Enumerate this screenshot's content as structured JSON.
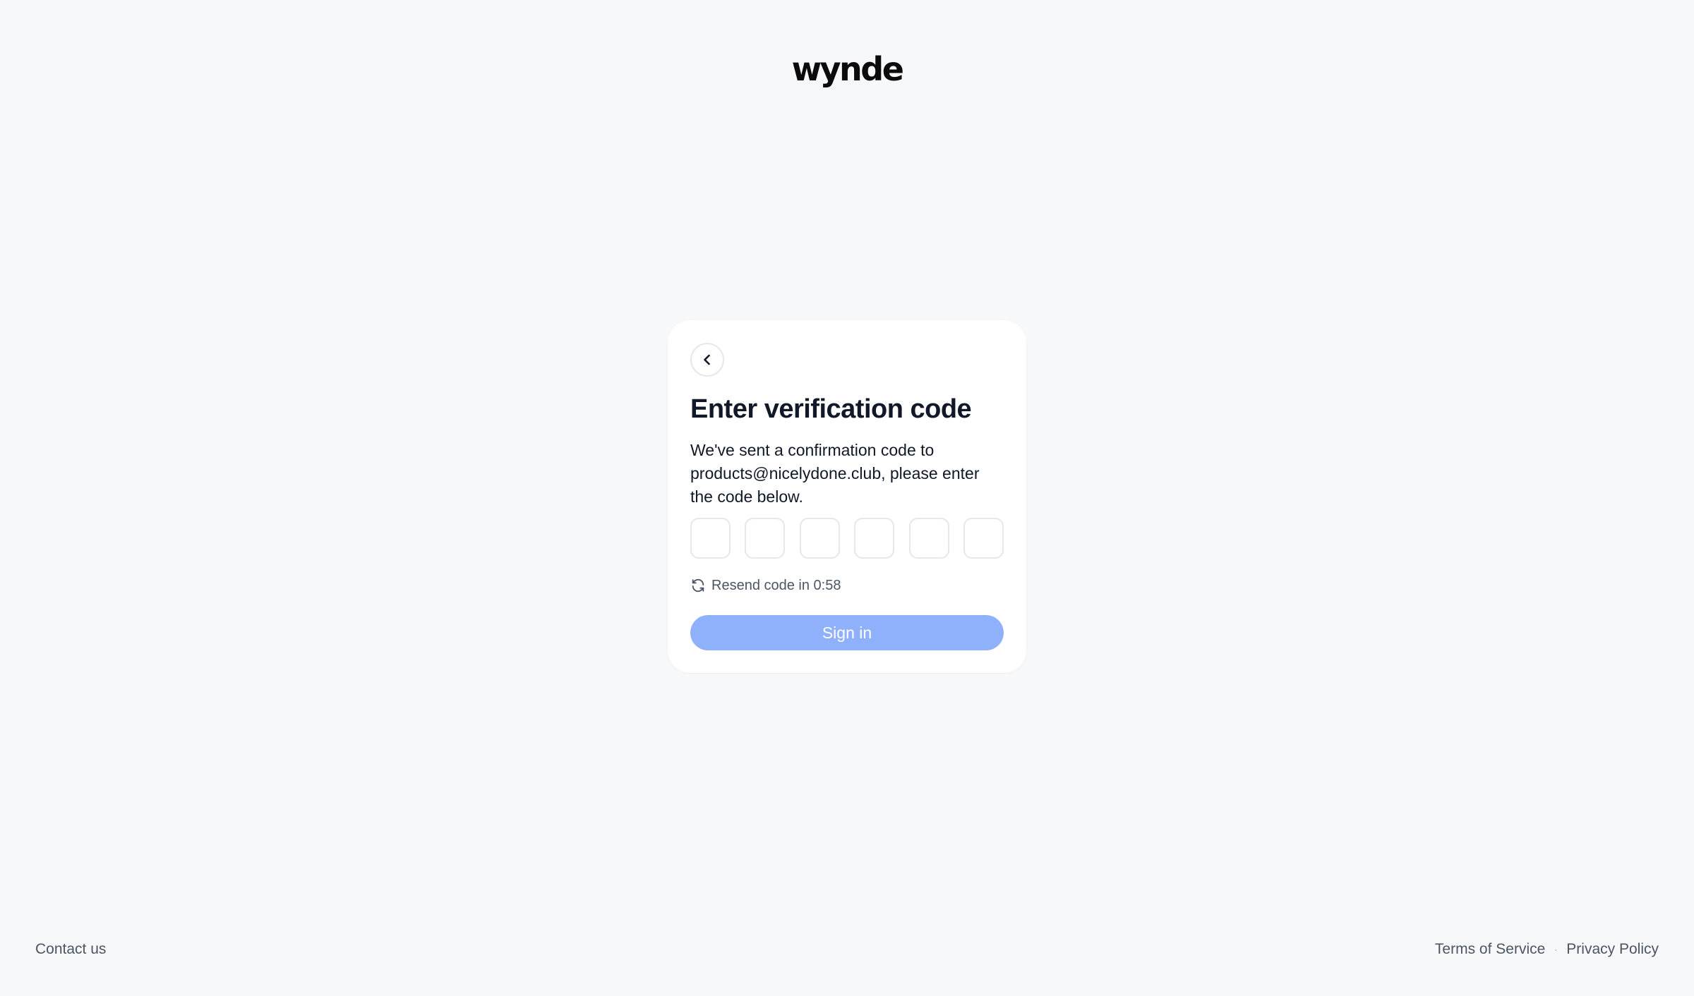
{
  "brand": {
    "logo_text": "wynde"
  },
  "card": {
    "back_icon": "chevron-left-icon",
    "title": "Enter verification code",
    "description": "We've sent a confirmation code to products@nicelydone.club, please enter the code below.",
    "code_fields": [
      "",
      "",
      "",
      "",
      "",
      ""
    ],
    "resend_icon": "refresh-icon",
    "resend_label": "Resend code in 0:58",
    "signin_label": "Sign in",
    "signin_color": "#8fb1fb"
  },
  "footer": {
    "contact": "Contact us",
    "separator": "·",
    "terms": "Terms of Service",
    "privacy": "Privacy Policy"
  }
}
